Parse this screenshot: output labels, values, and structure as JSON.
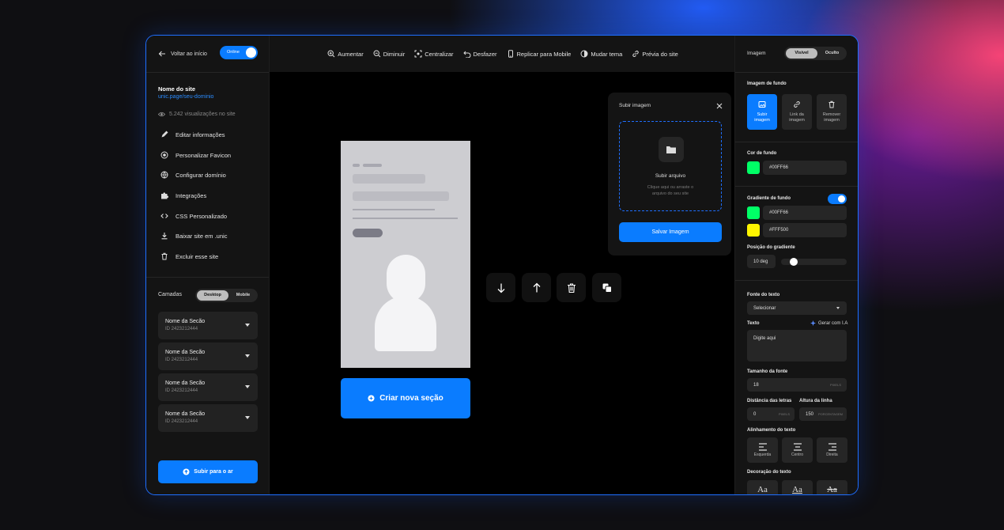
{
  "left": {
    "back_label": "Voltar ao início",
    "online_label": "Online",
    "site_name": "Nome do site",
    "site_url": "unic.page/seu-dominio",
    "views": "5.242 visualizações no site",
    "menu": [
      {
        "label": "Editar informações",
        "icon": "pencil-icon"
      },
      {
        "label": "Personalizar Favicon",
        "icon": "favicon-icon"
      },
      {
        "label": "Configurar domínio",
        "icon": "globe-icon"
      },
      {
        "label": "Integrações",
        "icon": "puzzle-icon"
      },
      {
        "label": "CSS Personalizado",
        "icon": "code-icon"
      },
      {
        "label": "Baixar site em .unic",
        "icon": "download-icon"
      },
      {
        "label": "Excluir esse site",
        "icon": "trash-icon"
      }
    ],
    "layers_label": "Camadas",
    "device_tabs": [
      "Desktop",
      "Mobile"
    ],
    "sections": [
      {
        "name": "Nome da Secão",
        "id": "ID 2423212444"
      },
      {
        "name": "Nome da Secão",
        "id": "ID 2423212444"
      },
      {
        "name": "Nome da Secão",
        "id": "ID 2423212444"
      },
      {
        "name": "Nome da Secão",
        "id": "ID 2423212444"
      }
    ],
    "publish_label": "Subir para o ar"
  },
  "toolbar": [
    {
      "label": "Aumentar",
      "icon": "zoom-in-icon"
    },
    {
      "label": "Diminuir",
      "icon": "zoom-out-icon"
    },
    {
      "label": "Centralizar",
      "icon": "center-icon"
    },
    {
      "label": "Desfazer",
      "icon": "undo-icon"
    },
    {
      "label": "Replicar para Mobile",
      "icon": "mobile-icon"
    },
    {
      "label": "Mudar tema",
      "icon": "theme-icon"
    },
    {
      "label": "Prévia do site",
      "icon": "link-icon"
    }
  ],
  "canvas": {
    "create_section_label": "Criar nova seção"
  },
  "upload": {
    "title": "Subir imagem",
    "drop_title": "Subir arquivo",
    "drop_hint_1": "Clique aqui ou arraste o",
    "drop_hint_2": "arquivo do seu site",
    "save_label": "Salvar Imagem"
  },
  "right": {
    "image_label": "Imagem",
    "vis_tabs": [
      "Visível",
      "Oculto"
    ],
    "bg_image_label": "Imagem de fundo",
    "tiles": [
      {
        "line1": "Subir",
        "line2": "imagem",
        "icon": "image-icon"
      },
      {
        "line1": "Link da",
        "line2": "imagem",
        "icon": "link-icon"
      },
      {
        "line1": "Remover",
        "line2": "imagem",
        "icon": "trash-icon"
      }
    ],
    "bg_color_label": "Cor de fundo",
    "bg_color": "#00FF66",
    "gradient_label": "Gradiente de fundo",
    "gradient_colors": [
      "#00FF66",
      "#FFF500"
    ],
    "gradient_pos_label": "Posição do gradiente",
    "gradient_deg": "10 deg",
    "font_label": "Fonte do texto",
    "font_value": "Selecionar",
    "text_label": "Texto",
    "ai_label": "Gerar com I.A",
    "text_placeholder": "Digite aqui",
    "font_size_label": "Tamanho da fonte",
    "font_size": "18",
    "font_size_unit": "PIXELS",
    "letter_spacing_label": "Distância das letras",
    "letter_spacing": "0",
    "letter_spacing_unit": "PIXELS",
    "line_height_label": "Altura da linha",
    "line_height": "150",
    "line_height_unit": "PORCENTAGEM",
    "align_label": "Alinhamento do texto",
    "align_options": [
      "Esquerda",
      "Centro",
      "Direita"
    ],
    "deco_label": "Decoração do texto",
    "deco_options": [
      "Aa",
      "Aa",
      "Aa"
    ]
  },
  "colors": {
    "accent": "#0a7cff",
    "green": "#00FF66",
    "yellow": "#FFF500"
  }
}
